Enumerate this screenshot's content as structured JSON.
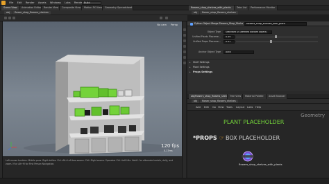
{
  "menubar": {
    "items": [
      "File",
      "Edit",
      "Render",
      "Assets",
      "Windows",
      "Labs",
      "RenderMan",
      "Help"
    ],
    "desktop": "Build"
  },
  "tabs_left": [
    "Scene View",
    "Animation Editor",
    "Render View",
    "Composite View",
    "Motion FX View",
    "Geometry Spreadsheet"
  ],
  "tabs_right": [
    "flowers_shop_shelves_with_plants",
    "Take List",
    "Performance Monitor"
  ],
  "path_left": [
    "obj",
    "flower_shop_flowers_shelves"
  ],
  "path_right": [
    "obj",
    "flower_shop_flowers_shelves"
  ],
  "viewport": {
    "view_label": "Persp",
    "camera_label": "No cam",
    "fps": "120 fps",
    "time": "0.17ms"
  },
  "status_text": "Left mouse tumbles. Middle pans. Right dollies. Ctrl+Alt+Left box-zooms. Ctrl+Right zooms. Spacebar Ctrl+Left tilts. Hold L for alternate tumble, dolly, and zoom. M or Alt+M for First Person Navigation.",
  "params": {
    "node_header": "Python Object Merge Flowers_Shop_Shelves_with_Plants",
    "node_name": "flowers_shop_shelves_with_plant",
    "object_type_label": "Object Type",
    "object_type_value": "Standard UI (defined bottom object)",
    "plants_label": "Unified Plants Placeme...",
    "plants_value": "0.49",
    "props_label": "Unified Props Placeme...",
    "props_value": "0.43",
    "anchor_label": "Anchor Object Type",
    "anchor_value": "Auto",
    "folders": [
      "Shelf Settings",
      "Plant Settings",
      "Props Settings"
    ],
    "plants_fraction": 0.49,
    "props_fraction": 0.43
  },
  "network": {
    "tabs": [
      "obj/flowers_shop_flowers_shelve",
      "Tree View",
      "Material Palette",
      "Asset Browser"
    ],
    "menu": [
      "Add",
      "Edit",
      "Go",
      "View",
      "Tools",
      "Layout",
      "Labs",
      "Help"
    ],
    "context_label": "Geometry",
    "plant_placeholder": "PLANT PLACEHOLDER",
    "props_label": "*PROPS",
    "box_placeholder": "BOX PLACEHOLDER",
    "node_label": "flowers_shop_shelves_with_plants"
  },
  "colors": {
    "plant": "#74d33a",
    "box": "#d8d8d8",
    "accent": "#e8a32a",
    "node": "#5fa0ff"
  }
}
